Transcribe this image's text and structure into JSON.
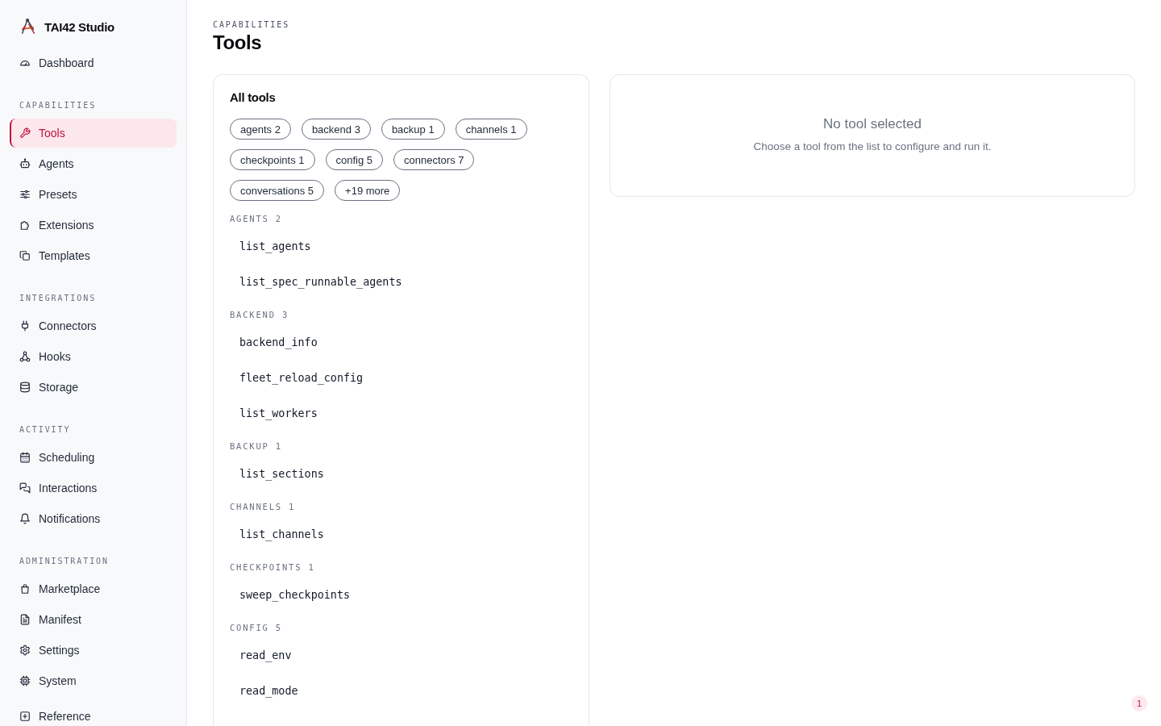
{
  "sidebar": {
    "brand": "TAI42 Studio",
    "sections": [
      {
        "items": [
          {
            "label": "Dashboard",
            "selected": false
          }
        ]
      },
      {
        "title": "CAPABILITIES",
        "items": [
          {
            "label": "Tools",
            "selected": true
          },
          {
            "label": "Agents",
            "selected": false
          },
          {
            "label": "Presets",
            "selected": false
          },
          {
            "label": "Extensions",
            "selected": false
          },
          {
            "label": "Templates",
            "selected": false
          }
        ]
      },
      {
        "title": "INTEGRATIONS",
        "items": [
          {
            "label": "Connectors",
            "selected": false
          },
          {
            "label": "Hooks",
            "selected": false
          },
          {
            "label": "Storage",
            "selected": false
          }
        ]
      },
      {
        "title": "ACTIVITY",
        "items": [
          {
            "label": "Scheduling",
            "selected": false
          },
          {
            "label": "Interactions",
            "selected": false
          },
          {
            "label": "Notifications",
            "selected": false
          }
        ]
      },
      {
        "title": "ADMINISTRATION",
        "items": [
          {
            "label": "Marketplace",
            "selected": false
          },
          {
            "label": "Manifest",
            "selected": false
          },
          {
            "label": "Settings",
            "selected": false
          },
          {
            "label": "System",
            "selected": false
          }
        ]
      },
      {
        "items": [
          {
            "label": "Reference",
            "selected": false
          }
        ]
      }
    ]
  },
  "header": {
    "section": "CAPABILITIES",
    "title": "Tools"
  },
  "tools_panel": {
    "title": "All tools",
    "filters": [
      "agents 2",
      "backend 3",
      "backup 1",
      "channels 1",
      "checkpoints 1",
      "config 5",
      "connectors 7",
      "conversations 5",
      "+19 more"
    ],
    "groups": [
      {
        "title": "AGENTS 2",
        "tools": [
          {
            "name": "list_agents",
            "selected": false
          },
          {
            "name": "list_spec_runnable_agents",
            "selected": false
          }
        ]
      },
      {
        "title": "BACKEND 3",
        "tools": [
          {
            "name": "backend_info",
            "selected": false
          },
          {
            "name": "fleet_reload_config",
            "selected": false
          },
          {
            "name": "list_workers",
            "selected": false
          }
        ]
      },
      {
        "title": "BACKUP 1",
        "tools": [
          {
            "name": "list_sections",
            "selected": false
          }
        ]
      },
      {
        "title": "CHANNELS 1",
        "tools": [
          {
            "name": "list_channels",
            "selected": false
          }
        ]
      },
      {
        "title": "CHECKPOINTS 1",
        "tools": [
          {
            "name": "sweep_checkpoints",
            "selected": false
          }
        ]
      },
      {
        "title": "CONFIG 5",
        "tools": [
          {
            "name": "read_env",
            "selected": false
          },
          {
            "name": "read_mode",
            "selected": false
          }
        ]
      }
    ]
  },
  "detail_panel": {
    "title": "No tool selected",
    "message": "Choose a tool from the list to configure and run it."
  },
  "badge": {
    "count": "1"
  }
}
